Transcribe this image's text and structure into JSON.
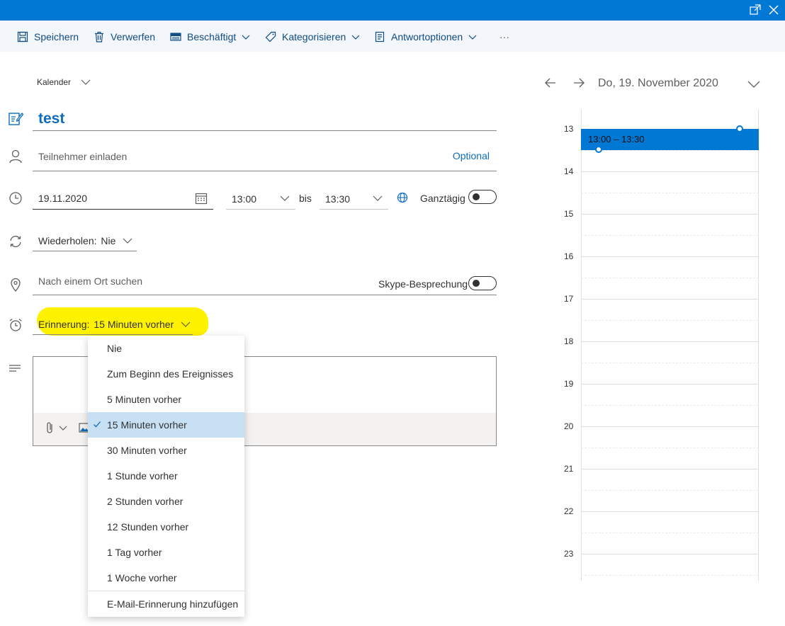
{
  "toolbar": {
    "save": "Speichern",
    "discard": "Verwerfen",
    "busy": "Beschäftigt",
    "categorize": "Kategorisieren",
    "response_options": "Antwortoptionen",
    "more": "···"
  },
  "calendar_picker": {
    "label": "Kalender"
  },
  "form": {
    "title": "test",
    "attendees_placeholder": "Teilnehmer einladen",
    "optional": "Optional",
    "start_date": "19.11.2020",
    "start_time": "13:00",
    "to_label": "bis",
    "end_time": "13:30",
    "all_day_label": "Ganztägig",
    "all_day_on": false,
    "repeat_label": "Wiederholen:",
    "repeat_value": "Nie",
    "location_placeholder": "Nach einem Ort suchen",
    "skype_label": "Skype-Besprechung",
    "skype_on": false,
    "reminder_label": "Erinnerung:",
    "reminder_value": "15 Minuten vorher"
  },
  "reminder_menu": {
    "items": [
      "Nie",
      "Zum Beginn des Ereignisses",
      "5 Minuten vorher",
      "15 Minuten vorher",
      "30 Minuten vorher",
      "1 Stunde vorher",
      "2 Stunden vorher",
      "12 Stunden vorher",
      "1 Tag vorher",
      "1 Woche vorher"
    ],
    "selected": "15 Minuten vorher",
    "email_reminder": "E-Mail-Erinnerung hinzufügen"
  },
  "day_view": {
    "date": "Do, 19. November 2020",
    "hours": [
      "13",
      "14",
      "15",
      "16",
      "17",
      "18",
      "19",
      "20",
      "21",
      "22",
      "23"
    ],
    "event_time": "13:00 – 13:30"
  },
  "colors": {
    "accent": "#0078d4",
    "highlight": "#fff200",
    "selected_item": "#c7e0f4"
  }
}
